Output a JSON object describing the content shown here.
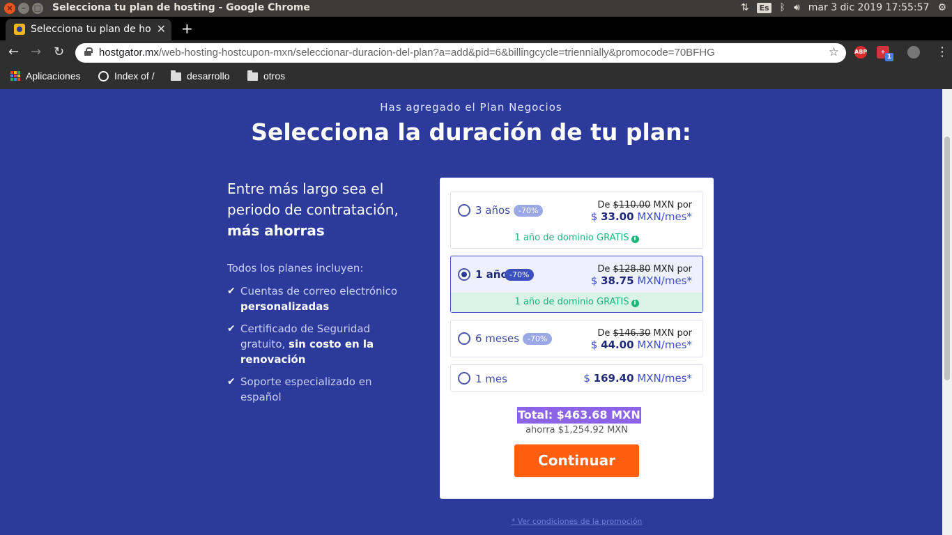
{
  "os": {
    "window_title": "Selecciona tu plan de hosting - Google Chrome",
    "keyboard_layout": "Es",
    "clock": "mar  3 dic 2019 17:55:57"
  },
  "browser": {
    "tab_title": "Selecciona tu plan de hosting - Google Chrome",
    "url_host": "hostgator.mx",
    "url_path": "/web-hosting-hostcupon-mxn/seleccionar-duracion-del-plan?a=add&pid=6&billingcycle=triennially&promocode=70BFHG",
    "ext_abp": "ABP",
    "ext_badge": "1",
    "bookmarks": [
      "Aplicaciones",
      "Index of /",
      "desarrollo",
      "otros"
    ]
  },
  "page": {
    "added_text": "Has agregado el Plan Negocios",
    "headline": "Selecciona la duración de tu plan:",
    "lead_line1": "Entre más largo sea el periodo de contratación,",
    "lead_bold": "más ahorras",
    "includes": "Todos los planes incluyen:",
    "features": [
      {
        "text": "Cuentas de correo electrónico ",
        "bold": "personalizadas",
        "after": ""
      },
      {
        "text": "Certificado de Seguridad gratuito, ",
        "bold": "sin costo en la renovación",
        "after": ""
      },
      {
        "text": "Soporte especializado en español",
        "bold": "",
        "after": ""
      }
    ]
  },
  "plans": [
    {
      "label": "3 años",
      "pct": "-70%",
      "from": "De",
      "old": "$110.00",
      "unit": "MXN por",
      "currency": "$",
      "price": "33.00",
      "per": "MXN/mes*",
      "domain": "1 año de dominio GRATIS",
      "selected": false
    },
    {
      "label": "1 año",
      "pct": "-70%",
      "from": "De",
      "old": "$128.80",
      "unit": "MXN por",
      "currency": "$",
      "price": "38.75",
      "per": "MXN/mes*",
      "domain": "1 año de dominio GRATIS",
      "selected": true
    },
    {
      "label": "6 meses",
      "pct": "-70%",
      "from": "De",
      "old": "$146.30",
      "unit": "MXN por",
      "currency": "$",
      "price": "44.00",
      "per": "MXN/mes*",
      "domain": "",
      "selected": false
    },
    {
      "label": "1 mes",
      "pct": "",
      "from": "",
      "old": "",
      "unit": "",
      "currency": "$",
      "price": "169.40",
      "per": "MXN/mes*",
      "domain": "",
      "selected": false
    }
  ],
  "summary": {
    "total": "Total: $463.68 MXN",
    "savings": "ahorra $1,254.92 MXN",
    "continue_label": "Continuar",
    "promo_link": "* Ver condiciones de la promoción"
  },
  "colors": {
    "page_bg": "#2b3a9b",
    "accent_orange": "#ff5f0e",
    "total_highlight": "#8b63e6",
    "domain_green": "#1bb77a"
  }
}
